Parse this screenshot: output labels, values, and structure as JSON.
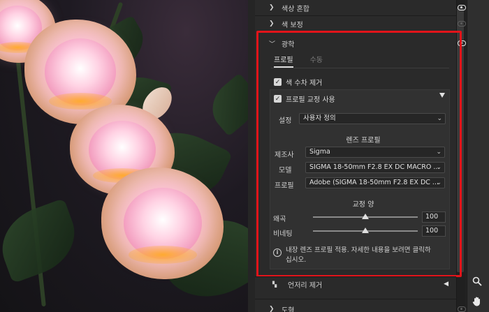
{
  "panel": {
    "sections_top": [
      {
        "title": "색상 혼합",
        "visible": true
      },
      {
        "title": "색 보정",
        "visible": false
      }
    ],
    "optics": {
      "title": "광학",
      "tabs": [
        "프로필",
        "수동"
      ],
      "active_tab": "프로필",
      "remove_ca_label": "색 수차 제거",
      "remove_ca_checked": true,
      "enable_profile_label": "프로필 교정 사용",
      "enable_profile_checked": true,
      "setup_label": "설정",
      "setup_value": "사용자 정의",
      "lens_profile_heading": "렌즈 프로필",
      "make_label": "제조사",
      "make_value": "Sigma",
      "model_label": "모델",
      "model_value": "SIGMA 18-50mm F2.8 EX DC MACRO ...",
      "profile_label": "프로필",
      "profile_value": "Adobe (SIGMA 18-50mm F2.8 EX DC ...",
      "amount_heading": "교정 양",
      "distortion_label": "왜곡",
      "distortion_value": "100",
      "vignetting_label": "비네팅",
      "vignetting_value": "100",
      "info_line1": "내장 렌즈 프로필 적용. 자세한 내용을 보려면 클릭하",
      "info_line2": "십시오."
    },
    "sections_bottom": [
      {
        "title": "언저리 제거"
      },
      {
        "title": "도형"
      }
    ]
  },
  "tools": [
    "zoom-tool",
    "hand-tool"
  ],
  "colors": {
    "highlight": "#e2141a",
    "panel_bg": "#2a2a2a"
  }
}
